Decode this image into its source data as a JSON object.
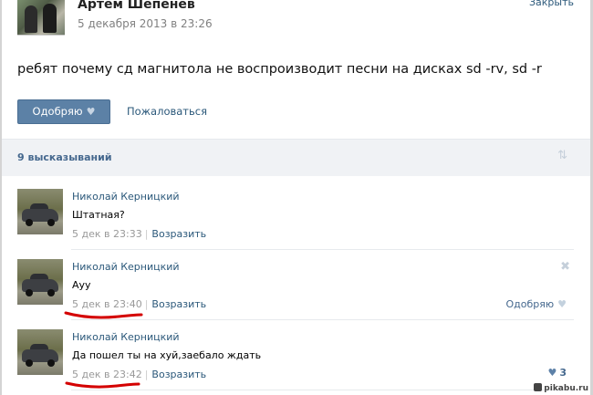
{
  "post": {
    "author": "Артем Шепенев",
    "date": "5 декабря 2013 в 23:26",
    "close_label": "Закрыть",
    "text": "ребят почему сд магнитола не воспроизводит песни на дисках sd -rv, sd -r",
    "like_label": "Одобряю",
    "report_label": "Пожаловаться"
  },
  "comments_header": {
    "count_label": "9 высказываний",
    "sort_icon": "sort-arrows-icon"
  },
  "comments": [
    {
      "author": "Николай Керницкий",
      "text": "Штатная?",
      "time": "5 дек в 23:33",
      "reply_label": "Возразить"
    },
    {
      "author": "Николай Керницкий",
      "text": "Ауу",
      "time": "5 дек в 23:40",
      "reply_label": "Возразить",
      "like_label": "Одобряю"
    },
    {
      "author": "Николай Керницкий",
      "text": "Да пошел ты на хуй,заебало ждать",
      "time": "5 дек в 23:42",
      "reply_label": "Возразить",
      "like_count": "3"
    }
  ],
  "watermark": "pikabu.ru",
  "colors": {
    "link": "#2b587a",
    "button": "#5c81a6",
    "annotation": "#d40000"
  }
}
